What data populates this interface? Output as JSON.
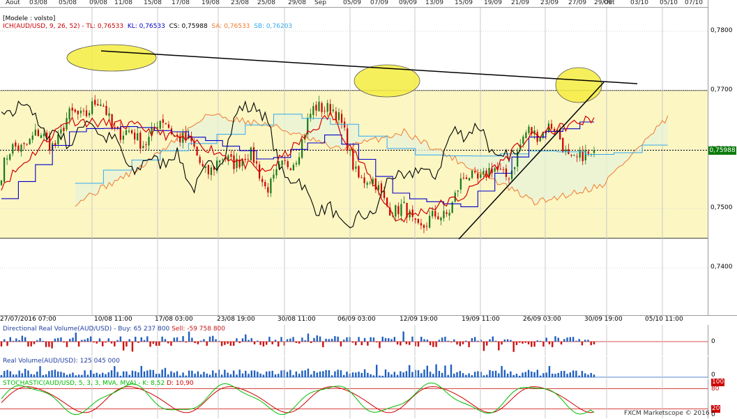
{
  "colors": {
    "band": "#fcf6c3",
    "kumo_bull": "#e8f3d8",
    "kumo_bear": "#fbe3c8",
    "tenkan": "#d40000",
    "kijun": "#0000c8",
    "chikou": "#000000",
    "senkou_a": "#f07a30",
    "senkou_b": "#33aaee",
    "candle_up": "#1a7a1a",
    "candle_down": "#cc0000",
    "vol_buy": "#1f5fbf",
    "vol_sell": "#cc1111",
    "stoch_k": "#00bb00",
    "stoch_d": "#cc0000",
    "ellipse": "#f4ec40",
    "current_price_bg": "#0a7a0a"
  },
  "top_dates": [
    "Août",
    "03/08",
    "05/08",
    "09/08",
    "11/08",
    "15/08",
    "17/08",
    "19/08",
    "23/08",
    "25/08",
    "29/08",
    "Sep",
    "05/09",
    "07/09",
    "09/09",
    "13/09",
    "15/09",
    "19/09",
    "21/09",
    "23/09",
    "27/09",
    "29/09",
    "Oct",
    "03/10",
    "05/10",
    "07/10"
  ],
  "header": {
    "model": "[Modele : volsto]",
    "ich_params": "ICH(AUD/USD, 9, 26, 52)",
    "tl": "TL: 0,76533",
    "kl": "KL: 0,76533",
    "cs": "CS: 0,75988",
    "sa": "SA: 0,76533",
    "sb": "SB: 0,76203"
  },
  "current_price": "0,75988",
  "bottom_dates": [
    "27/07/2016 07:00",
    "10/08 11:00",
    "17/08 03:00",
    "23/08 19:00",
    "30/08 11:00",
    "06/09 03:00",
    "12/09 19:00",
    "19/09 11:00",
    "26/09 03:00",
    "30/09 19:00",
    "05/10 11:00"
  ],
  "directional_volume": {
    "title": "Directional Real Volume(AUD/USD) -",
    "buy": "Buy: 65 237 800",
    "sell": "Sell: -59 758 800",
    "axis_label": "0"
  },
  "real_volume": {
    "title": "Real Volume(AUD/USD): 125 045 000",
    "axis_label": "0"
  },
  "stochastic": {
    "title": "STOCHASTIC(AUD/USD, 5, 3, 3, MVA, MVA) -",
    "k": "K: 8,52",
    "d": "D: 10,90",
    "axis_labels": [
      "100",
      "80",
      "20",
      "0"
    ]
  },
  "footer": "FXCM Marketscope © 2016",
  "chart_data": [
    {
      "type": "line",
      "title": "ICH(AUD/USD, 9, 26, 52)",
      "x": [
        "27/07/2016 07:00",
        "10/08 11:00",
        "17/08 03:00",
        "23/08 19:00",
        "30/08 11:00",
        "06/09 03:00",
        "12/09 19:00",
        "19/09 11:00",
        "26/09 03:00",
        "30/09 19:00"
      ],
      "ylim": [
        0.732,
        0.784
      ],
      "y_ticks": [
        "0,7800",
        "0,7700",
        "0,7600",
        "0,7500",
        "0,7400"
      ],
      "horizontal_levels": [
        0.77,
        0.745
      ],
      "current_price": 0.75988,
      "series": [
        {
          "name": "Close",
          "values": [
            0.756,
            0.766,
            0.764,
            0.76,
            0.755,
            0.767,
            0.747,
            0.752,
            0.762,
            0.75988
          ]
        },
        {
          "name": "TL",
          "values": [
            0.754,
            0.765,
            0.764,
            0.761,
            0.756,
            0.766,
            0.748,
            0.752,
            0.762,
            0.76533
          ]
        },
        {
          "name": "KL",
          "values": [
            0.752,
            0.763,
            0.764,
            0.762,
            0.758,
            0.763,
            0.752,
            0.75,
            0.762,
            0.76533
          ]
        },
        {
          "name": "SA",
          "values": [
            0.751,
            0.757,
            0.766,
            0.764,
            0.76,
            0.763,
            0.757,
            0.751,
            0.754,
            0.76533
          ]
        },
        {
          "name": "SB",
          "values": [
            0.7545,
            0.759,
            0.762,
            0.766,
            0.764,
            0.759,
            0.759,
            0.76,
            0.759,
            0.76203
          ]
        }
      ],
      "grid": true,
      "legend": "top-left"
    },
    {
      "type": "bar",
      "title": "Directional Real Volume(AUD/USD)",
      "series": [
        {
          "name": "Buy",
          "values": [
            65237800
          ]
        },
        {
          "name": "Sell",
          "values": [
            -59758800
          ]
        }
      ]
    },
    {
      "type": "bar",
      "title": "Real Volume(AUD/USD)",
      "values": [
        125045000
      ]
    },
    {
      "type": "line",
      "title": "STOCHASTIC(AUD/USD, 5, 3, 3, MVA, MVA)",
      "ylim": [
        0,
        100
      ],
      "horizontal_levels": [
        80,
        20
      ],
      "series": [
        {
          "name": "K",
          "values": [
            8.52
          ]
        },
        {
          "name": "D",
          "values": [
            10.9
          ]
        }
      ]
    }
  ]
}
